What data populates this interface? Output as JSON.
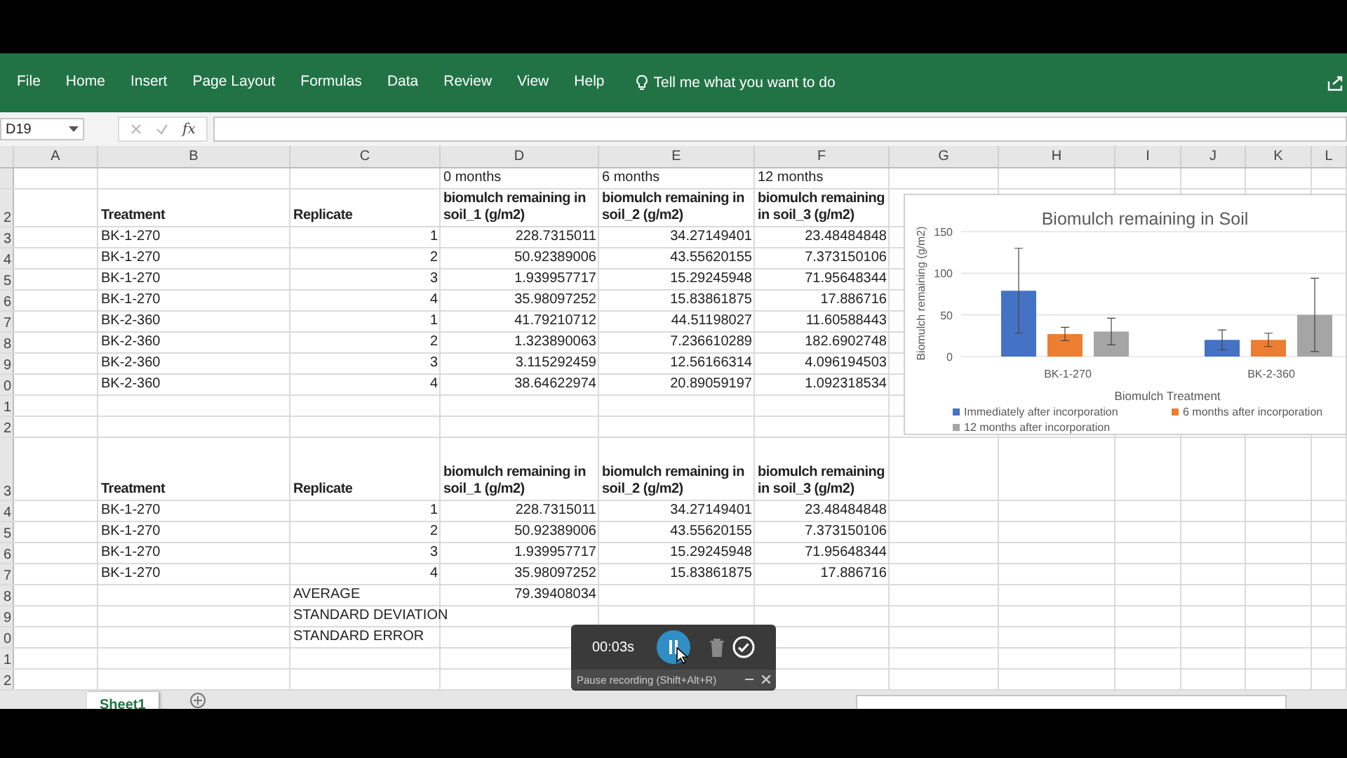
{
  "ribbon": {
    "tabs": [
      {
        "label": "File",
        "selected": false
      },
      {
        "label": "Home",
        "selected": false
      },
      {
        "label": "Insert",
        "selected": false
      },
      {
        "label": "Page Layout",
        "selected": false
      },
      {
        "label": "Formulas",
        "selected": false
      },
      {
        "label": "Data",
        "selected": false
      },
      {
        "label": "Review",
        "selected": false
      },
      {
        "label": "View",
        "selected": false
      },
      {
        "label": "Help",
        "selected": false
      }
    ],
    "tell_me": "Tell me what you want to do"
  },
  "formula_bar": {
    "name_box": "D19",
    "function_label": "fx"
  },
  "column_headers": [
    "A",
    "B",
    "C",
    "D",
    "E",
    "F",
    "G",
    "H",
    "I",
    "J",
    "K",
    "L"
  ],
  "rows": [
    {
      "kind": "title",
      "cells": {
        "D": "0 months",
        "E": "6 months",
        "F": "12 months"
      }
    },
    {
      "kind": "header",
      "row_label": "2",
      "cells": {
        "B": "Treatment",
        "C": "Replicate",
        "D": "biomulch remaining in soil_1 (g/m2)",
        "E": "biomulch remaining in soil_2 (g/m2)",
        "F": "biomulch remaining in soil_3 (g/m2)"
      }
    },
    {
      "kind": "data",
      "row_label": "3",
      "cells": {
        "B": "BK-1-270",
        "C": "1",
        "D": "228.7315011",
        "E": "34.27149401",
        "F": "23.48484848"
      }
    },
    {
      "kind": "data",
      "row_label": "4",
      "cells": {
        "B": "BK-1-270",
        "C": "2",
        "D": "50.92389006",
        "E": "43.55620155",
        "F": "7.373150106"
      }
    },
    {
      "kind": "data",
      "row_label": "5",
      "cells": {
        "B": "BK-1-270",
        "C": "3",
        "D": "1.939957717",
        "E": "15.29245948",
        "F": "71.95648344"
      }
    },
    {
      "kind": "data",
      "row_label": "6",
      "cells": {
        "B": "BK-1-270",
        "C": "4",
        "D": "35.98097252",
        "E": "15.83861875",
        "F": "17.886716"
      }
    },
    {
      "kind": "data",
      "row_label": "7",
      "cells": {
        "B": "BK-2-360",
        "C": "1",
        "D": "41.79210712",
        "E": "44.51198027",
        "F": "11.60588443"
      }
    },
    {
      "kind": "data",
      "row_label": "8",
      "cells": {
        "B": "BK-2-360",
        "C": "2",
        "D": "1.323890063",
        "E": "7.236610289",
        "F": "182.6902748"
      }
    },
    {
      "kind": "data",
      "row_label": "9",
      "cells": {
        "B": "BK-2-360",
        "C": "3",
        "D": "3.115292459",
        "E": "12.56166314",
        "F": "4.096194503"
      }
    },
    {
      "kind": "data",
      "row_label": "0",
      "cells": {
        "B": "BK-2-360",
        "C": "4",
        "D": "38.64622974",
        "E": "20.89059197",
        "F": "1.092318534"
      }
    },
    {
      "kind": "data",
      "row_label": "1",
      "cells": {}
    },
    {
      "kind": "data",
      "row_label": "2",
      "cells": {}
    },
    {
      "kind": "tall_header",
      "row_label": "3",
      "cells": {
        "B": "Treatment",
        "C": "Replicate",
        "D": "biomulch remaining in soil_1 (g/m2)",
        "E": "biomulch remaining in soil_2 (g/m2)",
        "F": "biomulch remaining in soil_3 (g/m2)"
      }
    },
    {
      "kind": "data",
      "row_label": "4",
      "cells": {
        "B": "BK-1-270",
        "C": "1",
        "D": "228.7315011",
        "E": "34.27149401",
        "F": "23.48484848"
      }
    },
    {
      "kind": "data",
      "row_label": "5",
      "cells": {
        "B": "BK-1-270",
        "C": "2",
        "D": "50.92389006",
        "E": "43.55620155",
        "F": "7.373150106"
      }
    },
    {
      "kind": "data",
      "row_label": "6",
      "cells": {
        "B": "BK-1-270",
        "C": "3",
        "D": "1.939957717",
        "E": "15.29245948",
        "F": "71.95648344"
      }
    },
    {
      "kind": "data",
      "row_label": "7",
      "cells": {
        "B": "BK-1-270",
        "C": "4",
        "D": "35.98097252",
        "E": "15.83861875",
        "F": "17.886716"
      }
    },
    {
      "kind": "summary",
      "row_label": "8",
      "cells": {
        "C": "AVERAGE",
        "D": "79.39408034"
      }
    },
    {
      "kind": "summary",
      "row_label": "9",
      "cells": {
        "C": "STANDARD DEVIATION"
      }
    },
    {
      "kind": "summary",
      "row_label": "0",
      "cells": {
        "C": "STANDARD ERROR"
      }
    },
    {
      "kind": "data",
      "row_label": "1",
      "cells": {}
    },
    {
      "kind": "data",
      "row_label": "2",
      "cells": {}
    }
  ],
  "chart": {
    "chart_data": {
      "type": "bar",
      "title": "Biomulch remaining in Soil",
      "xlabel": "Biomulch Treatment",
      "ylabel": "Biomulch remaining (g/m2)",
      "categories": [
        "BK-1-270",
        "BK-2-360"
      ],
      "legend": "bottom",
      "series": [
        {
          "name": "Immediately after incorporation",
          "color": "#4472c4",
          "values": [
            79,
            20
          ],
          "errors": [
            51,
            12
          ]
        },
        {
          "name": "6 months after incorporation",
          "color": "#ed7d31",
          "values": [
            27,
            20
          ],
          "errors": [
            8,
            8
          ]
        },
        {
          "name": "12 months after incorporation",
          "color": "#a5a5a5",
          "values": [
            30,
            50
          ],
          "errors": [
            16,
            44
          ]
        }
      ],
      "ylim": [
        0,
        150
      ],
      "yticks": [
        0,
        50,
        100,
        150
      ]
    }
  },
  "sheet_tabs": [
    {
      "label": "Sheet1",
      "selected": true
    }
  ],
  "recorder": {
    "time": "00:03s",
    "tooltip": "Pause recording (Shift+Alt+R)"
  }
}
